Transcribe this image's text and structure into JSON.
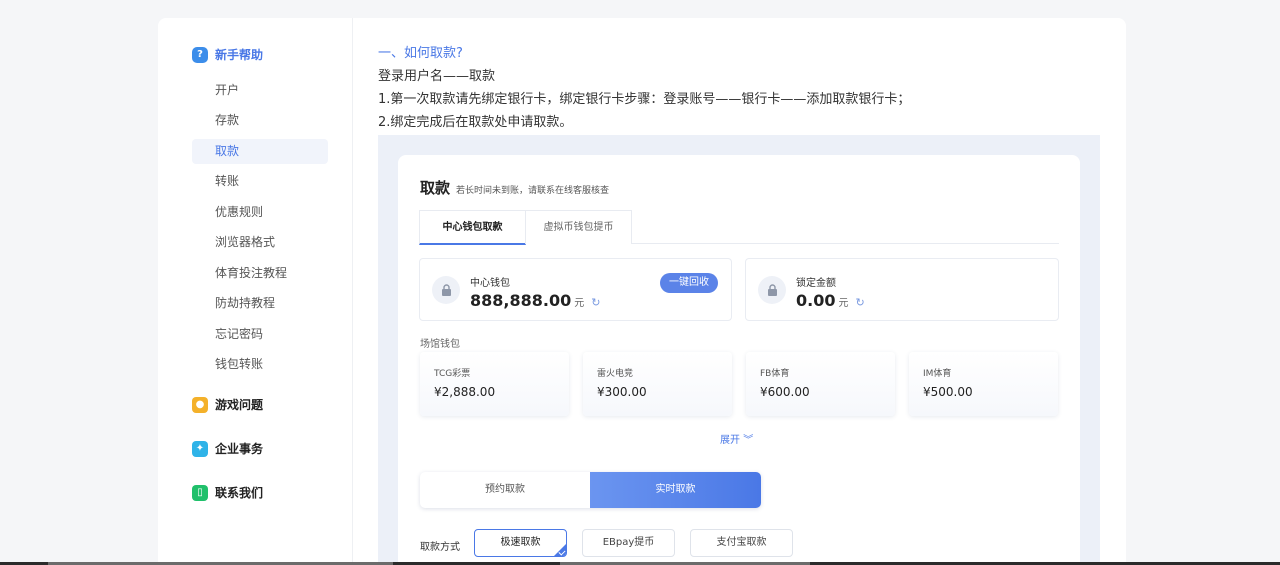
{
  "sidebar": {
    "categories": {
      "help": {
        "label": "新手帮助",
        "icon": "question-icon"
      },
      "game": {
        "label": "游戏问题",
        "icon": "game-icon"
      },
      "business": {
        "label": "企业事务",
        "icon": "business-icon"
      },
      "contact": {
        "label": "联系我们",
        "icon": "phone-icon"
      }
    },
    "help_items": [
      "开户",
      "存款",
      "取款",
      "转账",
      "优惠规则",
      "浏览器格式",
      "体育投注教程",
      "防劫持教程",
      "忘记密码",
      "钱包转账"
    ],
    "active_item": "取款"
  },
  "article": {
    "question": "一、如何取款?",
    "lines": [
      "登录用户名——取款",
      "1.第一次取款请先绑定银行卡，绑定银行卡步骤：登录账号——银行卡——添加取款银行卡；",
      "2.绑定完成后在取款处申请取款。"
    ]
  },
  "withdraw": {
    "title": "取款",
    "subtitle": "若长时间未到账，请联系在线客服核查",
    "tabs": [
      "中心钱包取款",
      "虚拟币钱包提币"
    ],
    "active_tab": "中心钱包取款",
    "center_wallet": {
      "label": "中心钱包",
      "amount": "888,888.00",
      "unit": "元",
      "recall_button": "一键回收"
    },
    "locked": {
      "label": "锁定金额",
      "amount": "0.00",
      "unit": "元"
    },
    "venue_title": "场馆钱包",
    "venues": [
      {
        "name": "TCG彩票",
        "amount": "¥2,888.00"
      },
      {
        "name": "雷火电竞",
        "amount": "¥300.00"
      },
      {
        "name": "FB体育",
        "amount": "¥600.00"
      },
      {
        "name": "IM体育",
        "amount": "¥500.00"
      }
    ],
    "expand_label": "展开",
    "modes": [
      "预约取款",
      "实时取款"
    ],
    "active_mode": "实时取款",
    "method_label": "取款方式",
    "methods": [
      "极速取款",
      "EBpay提币",
      "支付宝取款"
    ],
    "active_method": "极速取款"
  },
  "colors": {
    "accent": "#4a78e6",
    "page_bg": "#f5f6f8",
    "shot_bg": "#ecf0f8"
  }
}
